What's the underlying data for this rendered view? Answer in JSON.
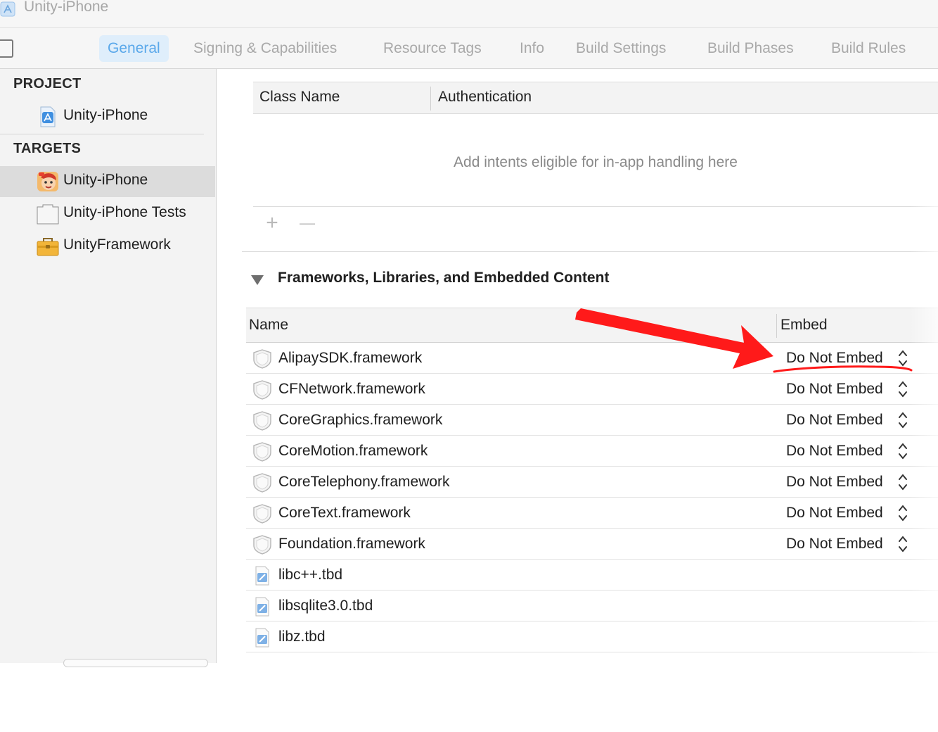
{
  "window": {
    "title": "Unity-iPhone"
  },
  "tabs": [
    {
      "label": "General",
      "active": true
    },
    {
      "label": "Signing & Capabilities",
      "active": false
    },
    {
      "label": "Resource Tags",
      "active": false
    },
    {
      "label": "Info",
      "active": false
    },
    {
      "label": "Build Settings",
      "active": false
    },
    {
      "label": "Build Phases",
      "active": false
    },
    {
      "label": "Build Rules",
      "active": false
    }
  ],
  "sidebar": {
    "project_header": "PROJECT",
    "project_item": "Unity-iPhone",
    "targets_header": "TARGETS",
    "targets": [
      {
        "label": "Unity-iPhone",
        "icon": "app-icon",
        "selected": true
      },
      {
        "label": "Unity-iPhone Tests",
        "icon": "test-bundle-icon",
        "selected": false
      },
      {
        "label": "UnityFramework",
        "icon": "framework-toolbox-icon",
        "selected": false
      }
    ]
  },
  "intents": {
    "col_class_name": "Class Name",
    "col_authentication": "Authentication",
    "placeholder": "Add intents eligible for in-app handling here",
    "add_symbol": "+",
    "remove_symbol": "—"
  },
  "frameworks": {
    "section_title": "Frameworks, Libraries, and Embedded Content",
    "col_name": "Name",
    "col_embed": "Embed",
    "rows": [
      {
        "name": "AlipaySDK.framework",
        "embed": "Do Not Embed",
        "icon": "framework-icon"
      },
      {
        "name": "CFNetwork.framework",
        "embed": "Do Not Embed",
        "icon": "framework-icon"
      },
      {
        "name": "CoreGraphics.framework",
        "embed": "Do Not Embed",
        "icon": "framework-icon"
      },
      {
        "name": "CoreMotion.framework",
        "embed": "Do Not Embed",
        "icon": "framework-icon"
      },
      {
        "name": "CoreTelephony.framework",
        "embed": "Do Not Embed",
        "icon": "framework-icon"
      },
      {
        "name": "CoreText.framework",
        "embed": "Do Not Embed",
        "icon": "framework-icon"
      },
      {
        "name": "Foundation.framework",
        "embed": "Do Not Embed",
        "icon": "framework-icon"
      },
      {
        "name": "libc++.tbd",
        "embed": "",
        "icon": "tbd-file-icon"
      },
      {
        "name": "libsqlite3.0.tbd",
        "embed": "",
        "icon": "tbd-file-icon"
      },
      {
        "name": "libz.tbd",
        "embed": "",
        "icon": "tbd-file-icon"
      }
    ]
  },
  "colors": {
    "accent": "#5aa8ea",
    "annotation_red": "#ff1a1a"
  }
}
